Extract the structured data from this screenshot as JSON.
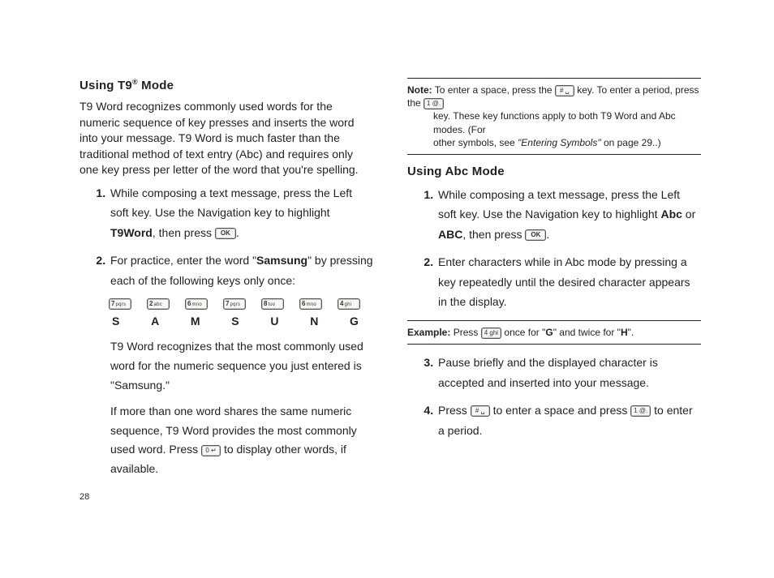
{
  "pageNumber": "28",
  "left": {
    "heading_pre": "Using T9",
    "heading_sup": "®",
    "heading_post": " Mode",
    "intro": "T9 Word recognizes commonly used words for the numeric sequence of key presses and inserts the word into your message. T9 Word is much faster than the traditional method of text entry (Abc) and requires only one key press per letter of the word that you're spelling.",
    "step1_a": "While composing a text message, press the Left soft key. Use the Navigation key to highlight ",
    "step1_b_bold": "T9Word",
    "step1_c": ", then press ",
    "ok": "OK",
    "step1_d": ".",
    "step2_a": "For practice, enter the word \"",
    "step2_bold": "Samsung",
    "step2_b": "\" by pressing each of the following keys only once:",
    "keys": [
      {
        "d": "7",
        "t": "pqrs"
      },
      {
        "d": "2",
        "t": "abc"
      },
      {
        "d": "6",
        "t": "mno"
      },
      {
        "d": "7",
        "t": "pqrs"
      },
      {
        "d": "8",
        "t": "tuv"
      },
      {
        "d": "6",
        "t": "mno"
      },
      {
        "d": "4",
        "t": "ghi"
      }
    ],
    "letters": [
      "S",
      "A",
      "M",
      "S",
      "U",
      "N",
      "G"
    ],
    "after1": "T9 Word recognizes that the most commonly used word for the numeric sequence you just entered is \"Samsung.\"",
    "after2_a": "If more than one word shares the same numeric sequence, T9 Word provides the most commonly used word. Press ",
    "zero_key": "0 ↵",
    "after2_b": " to display other words, if available."
  },
  "right": {
    "note_label": "Note:",
    "note_a": " To enter a space, press the ",
    "pound_key": "# ␣",
    "note_b": " key. To enter a period, press the ",
    "one_key": "1 @.",
    "note_c1": "key. These key functions apply to both T9 Word and Abc modes. (For",
    "note_c2": "other symbols, see ",
    "note_ital": "\"Entering Symbols\"",
    "note_c3": " on page 29..)",
    "heading": "Using Abc Mode",
    "s1_a": "While composing a text message, press the Left soft key. Use the Navigation key to highlight ",
    "s1_bold1": "Abc",
    "s1_mid": " or ",
    "s1_bold2": "ABC",
    "s1_b": ", then press ",
    "ok": "OK",
    "s1_c": ".",
    "s2": "Enter characters while in Abc mode by pressing a key repeatedly until the desired character appears in the display.",
    "ex_label": "Example:",
    "ex_a": " Press ",
    "four_key": "4 ghi",
    "ex_b": " once for \"",
    "ex_G": "G",
    "ex_c": "\" and twice for \"",
    "ex_H": "H",
    "ex_d": "\".",
    "s3": "Pause briefly and the displayed character is accepted and inserted into your message.",
    "s4_a": "Press ",
    "s4_b": " to enter a space and press ",
    "s4_c": " to enter a period."
  }
}
